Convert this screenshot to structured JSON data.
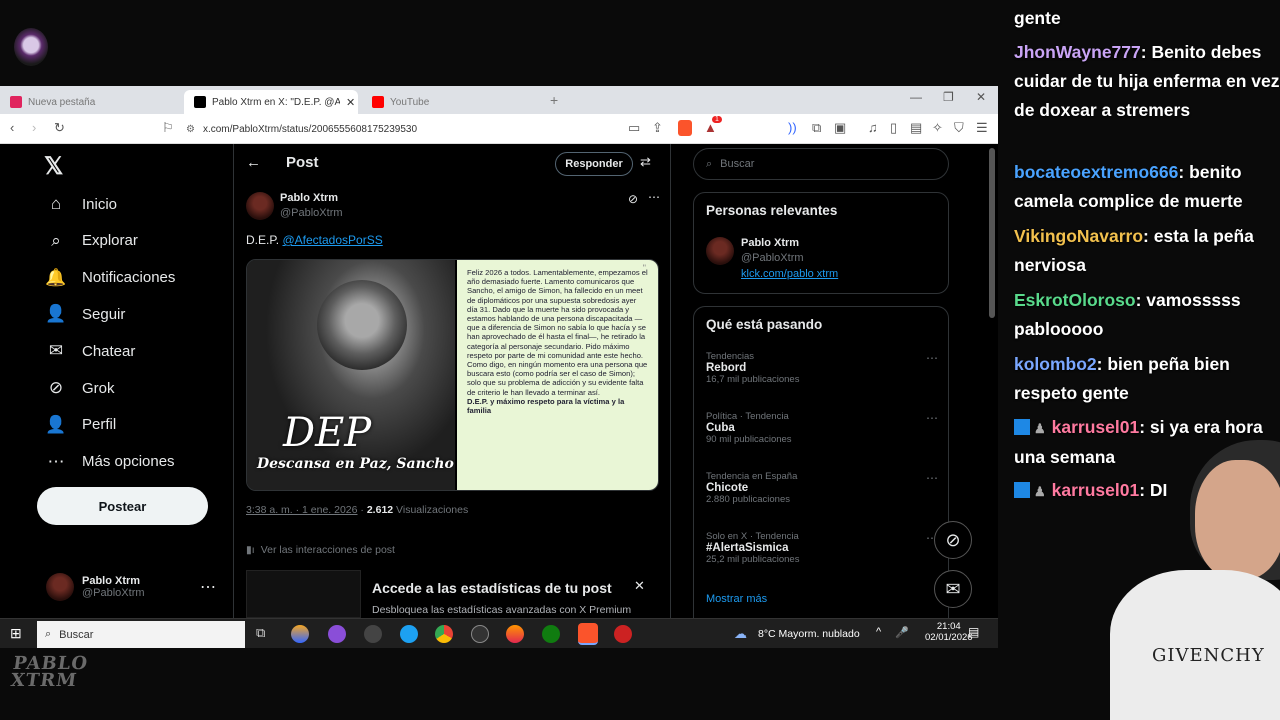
{
  "tabs": [
    {
      "label": "Nueva pestaña",
      "color": "#e0245e"
    },
    {
      "label": "Pablo Xtrm en X: \"D.E.P. @Afecta",
      "color": "#000000"
    },
    {
      "label": "YouTube",
      "color": "#ff0000"
    }
  ],
  "address": {
    "url": "x.com/PabloXtrm/status/2006555608175239530",
    "badge": "1"
  },
  "nav": {
    "items": [
      {
        "label": "Inicio",
        "icon": "home-icon",
        "glyph": "⌂"
      },
      {
        "label": "Explorar",
        "icon": "search-icon",
        "glyph": "⌕"
      },
      {
        "label": "Notificaciones",
        "icon": "bell-icon",
        "glyph": "🔔"
      },
      {
        "label": "Seguir",
        "icon": "follow-icon",
        "glyph": "👤"
      },
      {
        "label": "Chatear",
        "icon": "mail-icon",
        "glyph": "✉"
      },
      {
        "label": "Grok",
        "icon": "grok-icon",
        "glyph": "⊘"
      },
      {
        "label": "Perfil",
        "icon": "profile-icon",
        "glyph": "👤"
      },
      {
        "label": "Más opciones",
        "icon": "more-icon",
        "glyph": "⋯"
      }
    ],
    "post_button": "Postear",
    "account": {
      "name": "Pablo Xtrm",
      "handle": "@PabloXtrm"
    }
  },
  "post": {
    "header": "Post",
    "reply_button": "Responder",
    "author": "Pablo Xtrm",
    "handle": "@PabloXtrm",
    "text_prefix": "D.E.P.",
    "mention": "@AfectadosPorSS",
    "image": {
      "dep": "DEP",
      "caption": "Descansa en Paz, Sancho",
      "note_text": "Feliz 2026 a todos. Lamentablemente, empezamos el año demasiado fuerte. Lamento comunicaros que Sancho, el amigo de Simon, ha fallecido en un meet de diplomáticos por una supuesta sobredosis ayer día 31. Dado que la muerte ha sido provocada y estamos hablando de una persona discapacitada —que a diferencia de Simon no sabía lo que hacía y se han aprovechado de él hasta el final—, he retirado la categoría al personaje secundario. Pido máximo respeto por parte de mi comunidad ante este hecho. Como digo, en ningún momento era una persona que buscara esto (como podría ser el caso de Simon); solo que su problema de adicción y su evidente falta de criterio le han llevado a terminar así.",
      "note_bold": "D.E.P. y máximo respeto para la víctima y la familia"
    },
    "time": "3:38 a. m. · 1 ene. 2026",
    "views": "2.612",
    "views_label": "Visualizaciones",
    "interactions": "Ver las interacciones de post",
    "premium_title": "Accede a las estadísticas de tu post",
    "premium_sub": "Desbloquea las estadísticas avanzadas con X Premium"
  },
  "sidebar": {
    "search_placeholder": "Buscar",
    "relevant_title": "Personas relevantes",
    "relevant": {
      "name": "Pablo Xtrm",
      "handle": "@PabloXtrm",
      "link": "klck.com/pablo xtrm"
    },
    "trending_title": "Qué está pasando",
    "trends": [
      {
        "cat": "Tendencias",
        "name": "Rebord",
        "count": "16,7 mil publicaciones"
      },
      {
        "cat": "Política · Tendencia",
        "name": "Cuba",
        "count": "90 mil publicaciones"
      },
      {
        "cat": "Tendencia en España",
        "name": "Chicote",
        "count": "2.880 publicaciones"
      },
      {
        "cat": "Solo en X · Tendencia",
        "name": "#AlertaSismica",
        "count": "25,2 mil publicaciones"
      }
    ],
    "show_more": "Mostrar más"
  },
  "taskbar": {
    "search": "Buscar",
    "weather": "8°C  Mayorm. nublado",
    "time": "21:04",
    "date": "02/01/2026"
  },
  "chat": [
    {
      "user": "",
      "msg": "gente",
      "color": "#ffffff"
    },
    {
      "user": "JhonWayne777",
      "msg": ": Benito debes cuidar de tu hija enferma en vez de doxear a stremers",
      "color": "#c9a4f5"
    },
    {
      "user": "bocateoextremo666",
      "msg": ": benito camela complice de muerte",
      "color": "#4aa3ff"
    },
    {
      "user": "VikingoNavarro",
      "msg": ": esta la peña nerviosa",
      "color": "#f2c14e"
    },
    {
      "user": "EskrotOloroso",
      "msg": ": vamosssss pablooooo",
      "color": "#59d98b"
    },
    {
      "user": "kolombo2",
      "msg": ": bien peña bien respeto gente",
      "color": "#7aa7ff"
    },
    {
      "user": "karrusel01",
      "msg": ": si ya era hora una semana",
      "color": "#ff7aa0"
    },
    {
      "user": "karrusel01",
      "msg": ": DI",
      "color": "#ff7aa0"
    }
  ],
  "brand": {
    "overlay_logo": "PABLO XTRM",
    "shirt": "GIVENCHY"
  }
}
